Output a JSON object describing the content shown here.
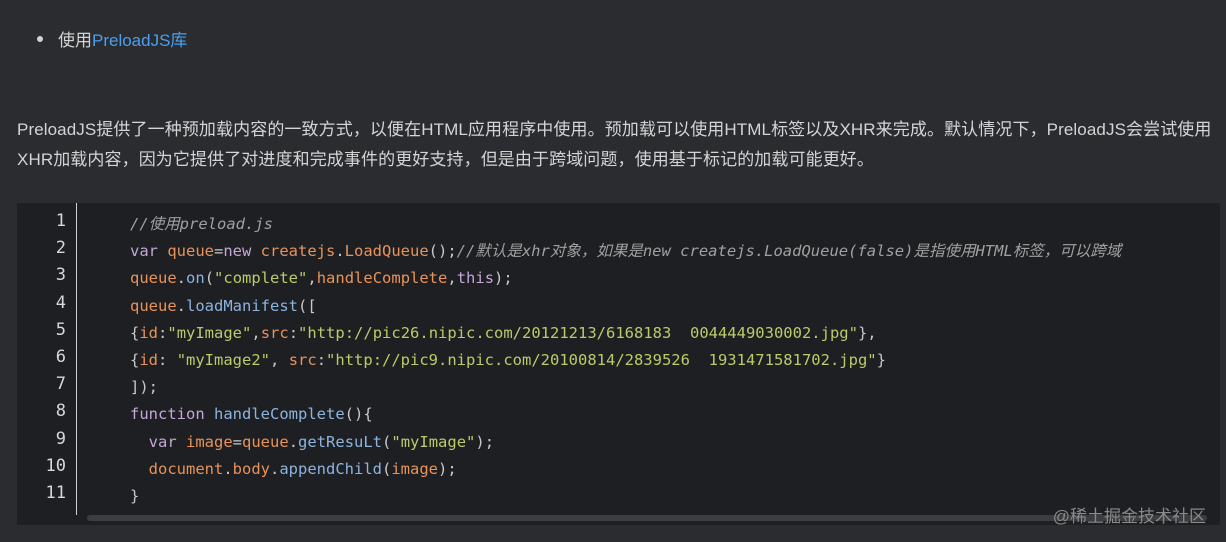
{
  "bullet": {
    "prefix": "使用",
    "link": "PreloadJS库"
  },
  "paragraph": "PreloadJS提供了一种预加载内容的一致方式，以便在HTML应用程序中使用。预加载可以使用HTML标签以及XHR来完成。默认情况下，PreloadJS会尝试使用XHR加载内容，因为它提供了对进度和完成事件的更好支持，但是由于跨域问题，使用基于标记的加载可能更好。",
  "code": {
    "line_numbers": [
      "1",
      "2",
      "3",
      "4",
      "5",
      "6",
      "7",
      "8",
      "9",
      "10",
      "11"
    ],
    "lines": [
      [
        [
          "c",
          "//使用preload.js"
        ]
      ],
      [
        [
          "k",
          "var "
        ],
        [
          "v",
          "queue"
        ],
        [
          "p",
          "="
        ],
        [
          "k",
          "new "
        ],
        [
          "v",
          "createjs"
        ],
        [
          "p",
          "."
        ],
        [
          "v",
          "LoadQueue"
        ],
        [
          "p",
          "();"
        ],
        [
          "c",
          "//默认是xhr对象，如果是new createjs.LoadQueue(false)是指使用HTML标签，可以跨域"
        ]
      ],
      [
        [
          "v",
          "queue"
        ],
        [
          "p",
          "."
        ],
        [
          "m",
          "on"
        ],
        [
          "p",
          "("
        ],
        [
          "s",
          "\"complete\""
        ],
        [
          "p",
          ","
        ],
        [
          "v",
          "handleComplete"
        ],
        [
          "p",
          ","
        ],
        [
          "k",
          "this"
        ],
        [
          "p",
          ");"
        ]
      ],
      [
        [
          "v",
          "queue"
        ],
        [
          "p",
          "."
        ],
        [
          "m",
          "loadManifest"
        ],
        [
          "p",
          "(["
        ]
      ],
      [
        [
          "p",
          "{"
        ],
        [
          "v",
          "id"
        ],
        [
          "p",
          ":"
        ],
        [
          "s",
          "\"myImage\""
        ],
        [
          "p",
          ","
        ],
        [
          "v",
          "src"
        ],
        [
          "p",
          ":"
        ],
        [
          "s",
          "\"http://pic26.nipic.com/20121213/6168183  0044449030002.jpg\""
        ],
        [
          "p",
          "},"
        ]
      ],
      [
        [
          "p",
          "{"
        ],
        [
          "v",
          "id"
        ],
        [
          "p",
          ": "
        ],
        [
          "s",
          "\"myImage2\""
        ],
        [
          "p",
          ", "
        ],
        [
          "v",
          "src"
        ],
        [
          "p",
          ":"
        ],
        [
          "s",
          "\"http://pic9.nipic.com/20100814/2839526  1931471581702.jpg\""
        ],
        [
          "p",
          "}"
        ]
      ],
      [
        [
          "p",
          "]);"
        ]
      ],
      [
        [
          "k",
          "function "
        ],
        [
          "m",
          "handleComplete"
        ],
        [
          "p",
          "(){"
        ]
      ],
      [
        [
          "p",
          "  "
        ],
        [
          "k",
          "var "
        ],
        [
          "v",
          "image"
        ],
        [
          "p",
          "="
        ],
        [
          "v",
          "queue"
        ],
        [
          "p",
          "."
        ],
        [
          "m",
          "getResuLt"
        ],
        [
          "p",
          "("
        ],
        [
          "s",
          "\"myImage\""
        ],
        [
          "p",
          ");"
        ]
      ],
      [
        [
          "p",
          "  "
        ],
        [
          "v",
          "document"
        ],
        [
          "p",
          "."
        ],
        [
          "v",
          "body"
        ],
        [
          "p",
          "."
        ],
        [
          "m",
          "appendChild"
        ],
        [
          "p",
          "("
        ],
        [
          "v",
          "image"
        ],
        [
          "p",
          ");"
        ]
      ],
      [
        [
          "p",
          "}"
        ]
      ]
    ]
  },
  "watermark": "@稀土掘金技术社区"
}
